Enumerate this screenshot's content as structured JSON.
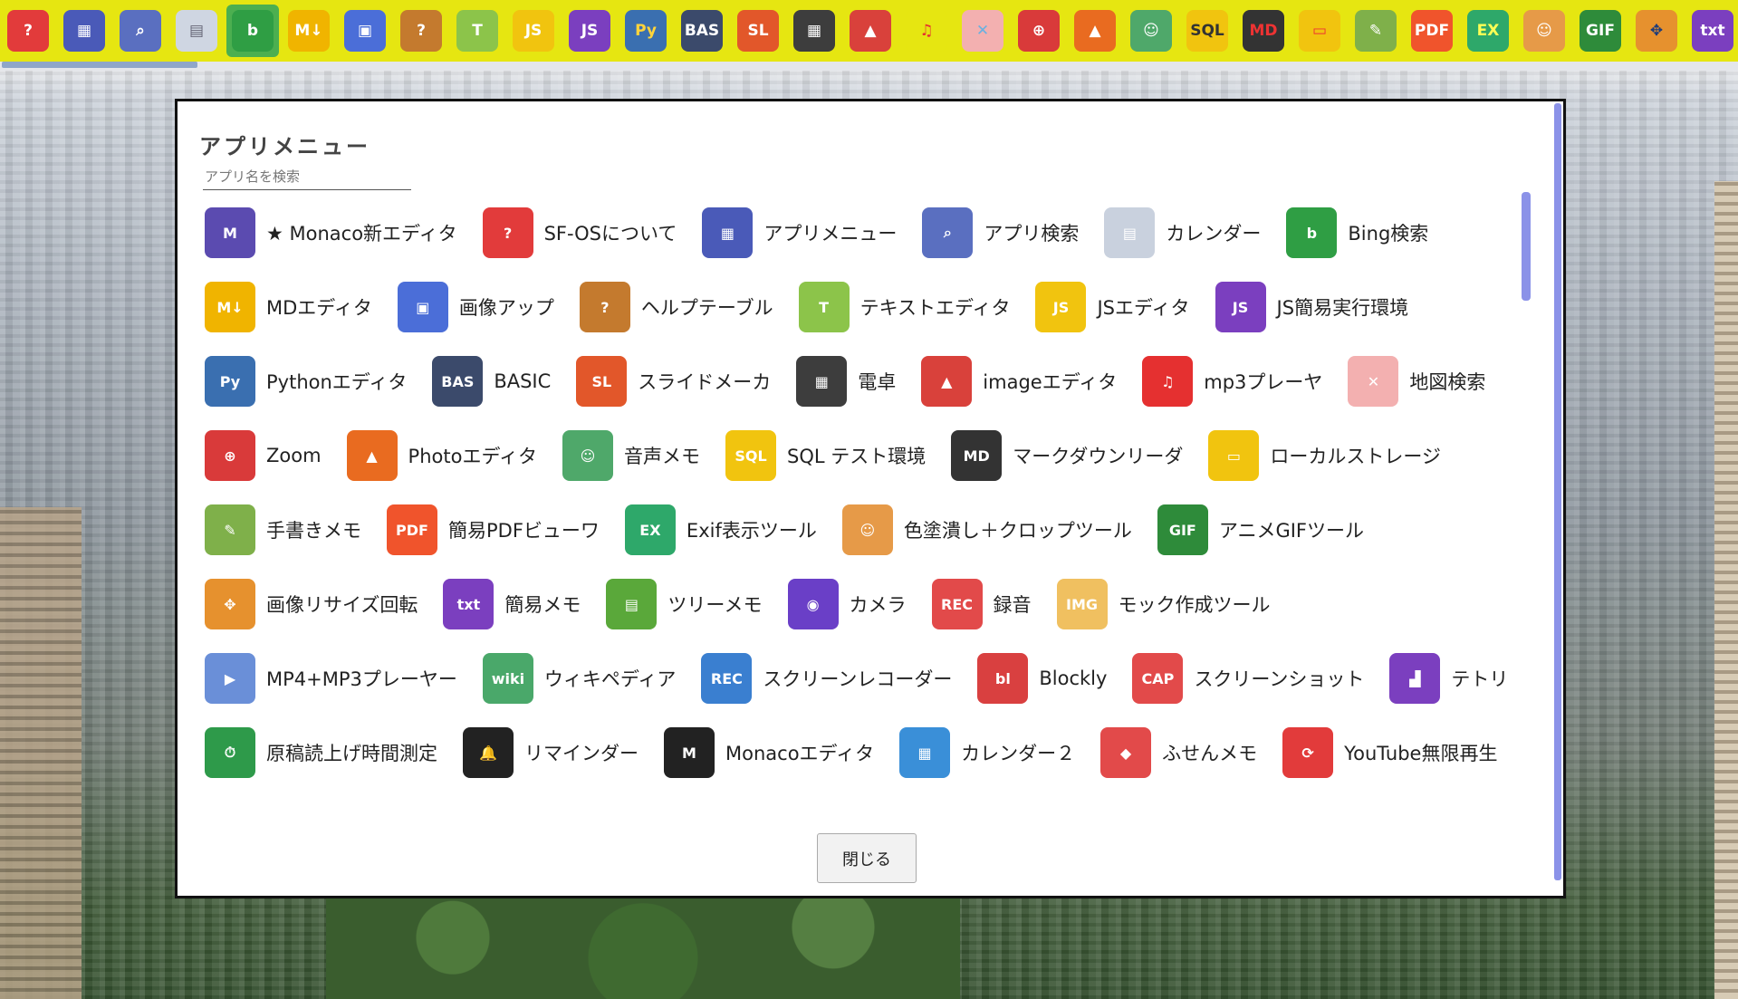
{
  "colors": {
    "taskbar": "#e6e611",
    "scrollbar": "#8b92e8",
    "dialog_border": "#111111"
  },
  "taskbar": {
    "items": [
      {
        "name": "help-icon",
        "glyph": "?",
        "bg": "#e23b3b",
        "fg": "#ffffff"
      },
      {
        "name": "app-menu-icon",
        "glyph": "▦",
        "bg": "#4a5ab8",
        "fg": "#ffffff"
      },
      {
        "name": "app-search-icon",
        "glyph": "⌕",
        "bg": "#5a6fc0",
        "fg": "#ffffff"
      },
      {
        "name": "calendar-icon",
        "glyph": "▤",
        "bg": "#cfd6e2",
        "fg": "#667"
      },
      {
        "name": "bing-icon",
        "glyph": "b",
        "bg": "#2f9e44",
        "fg": "#ffffff",
        "active": true
      },
      {
        "name": "md-editor-icon",
        "glyph": "M↓",
        "bg": "#f0b400",
        "fg": "#ffffff"
      },
      {
        "name": "image-up-icon",
        "glyph": "▣",
        "bg": "#4b6ed8",
        "fg": "#ffffff"
      },
      {
        "name": "help-table-icon",
        "glyph": "?",
        "bg": "#c47a2e",
        "fg": "#ffffff"
      },
      {
        "name": "text-editor-icon",
        "glyph": "T",
        "bg": "#8cc44a",
        "fg": "#ffffff"
      },
      {
        "name": "js-editor-icon",
        "glyph": "JS",
        "bg": "#f1c40f",
        "fg": "#ffffff"
      },
      {
        "name": "js-run-icon",
        "glyph": "JS",
        "bg": "#7b3fbf",
        "fg": "#ffffff"
      },
      {
        "name": "python-icon",
        "glyph": "Py",
        "bg": "#3a6fb0",
        "fg": "#ffd43b"
      },
      {
        "name": "basic-icon",
        "glyph": "BAS",
        "bg": "#3b4a6b",
        "fg": "#ffffff"
      },
      {
        "name": "slide-icon",
        "glyph": "SL",
        "bg": "#e2572a",
        "fg": "#ffffff"
      },
      {
        "name": "calculator-icon",
        "glyph": "▦",
        "bg": "#3d3d3d",
        "fg": "#ffffff"
      },
      {
        "name": "image-editor-icon",
        "glyph": "▲",
        "bg": "#d9413b",
        "fg": "#ffffff"
      },
      {
        "name": "music-icon",
        "glyph": "♫",
        "bg": "#e6e611",
        "fg": "#e53030"
      },
      {
        "name": "map-icon",
        "glyph": "✕",
        "bg": "#f3b0b0",
        "fg": "#6ab0e0"
      },
      {
        "name": "zoom-icon",
        "glyph": "⊕",
        "bg": "#d93a3a",
        "fg": "#ffffff"
      },
      {
        "name": "photo-editor-icon",
        "glyph": "▲",
        "bg": "#e96b20",
        "fg": "#ffffff"
      },
      {
        "name": "voice-memo-icon",
        "glyph": "☺",
        "bg": "#4fa86a",
        "fg": "#ffffff"
      },
      {
        "name": "sql-icon",
        "glyph": "SQL",
        "bg": "#f1c40f",
        "fg": "#333333"
      },
      {
        "name": "md-reader-icon",
        "glyph": "MD",
        "bg": "#333333",
        "fg": "#e33"
      },
      {
        "name": "storage-icon",
        "glyph": "▭",
        "bg": "#f1c40f",
        "fg": "#e33"
      },
      {
        "name": "handwrite-icon",
        "glyph": "✎",
        "bg": "#7fb04a",
        "fg": "#ffffff"
      },
      {
        "name": "pdf-icon",
        "glyph": "PDF",
        "bg": "#f0542c",
        "fg": "#ffffff"
      },
      {
        "name": "exif-icon",
        "glyph": "EX",
        "bg": "#2ea86a",
        "fg": "#ffff55"
      },
      {
        "name": "crop-icon",
        "glyph": "☺",
        "bg": "#e69a48",
        "fg": "#ffffff"
      },
      {
        "name": "gif-icon",
        "glyph": "GIF",
        "bg": "#2e8b3a",
        "fg": "#ffffff"
      },
      {
        "name": "rotate-icon",
        "glyph": "✥",
        "bg": "#e6912e",
        "fg": "#1c3b7a"
      },
      {
        "name": "memo-icon",
        "glyph": "txt",
        "bg": "#7b3fbf",
        "fg": "#ffffff"
      }
    ]
  },
  "dialog": {
    "title": "アプリメニュー",
    "search_placeholder": "アプリ名を検索",
    "close_label": "閉じる",
    "rows": [
      [
        {
          "label": "★ Monaco新エディタ",
          "icon": "laptop-icon",
          "glyph": "M",
          "bg": "#5b4bb0"
        },
        {
          "label": "SF-OSについて",
          "icon": "help-icon",
          "glyph": "?",
          "bg": "#e23b3b"
        },
        {
          "label": "アプリメニュー",
          "icon": "app-menu-icon",
          "glyph": "▦",
          "bg": "#4a5ab8"
        },
        {
          "label": "アプリ検索",
          "icon": "app-search-icon",
          "glyph": "⌕",
          "bg": "#5a6fc0"
        },
        {
          "label": "カレンダー",
          "icon": "calendar-icon",
          "glyph": "▤",
          "bg": "#c9d1de"
        },
        {
          "label": "Bing検索",
          "icon": "bing-icon",
          "glyph": "b",
          "bg": "#2f9e44"
        }
      ],
      [
        {
          "label": "MDエディタ",
          "icon": "md-editor-icon",
          "glyph": "M↓",
          "bg": "#f0b400"
        },
        {
          "label": "画像アップ",
          "icon": "image-up-icon",
          "glyph": "▣",
          "bg": "#4b6ed8"
        },
        {
          "label": "ヘルプテーブル",
          "icon": "help-table-icon",
          "glyph": "?",
          "bg": "#c47a2e"
        },
        {
          "label": "テキストエディタ",
          "icon": "text-editor-icon",
          "glyph": "T",
          "bg": "#8cc44a"
        },
        {
          "label": "JSエディタ",
          "icon": "js-editor-icon",
          "glyph": "JS",
          "bg": "#f1c40f"
        },
        {
          "label": "JS簡易実行環境",
          "icon": "js-run-icon",
          "glyph": "JS",
          "bg": "#7b3fbf"
        }
      ],
      [
        {
          "label": "Pythonエディタ",
          "icon": "python-icon",
          "glyph": "Py",
          "bg": "#3a6fb0"
        },
        {
          "label": "BASIC",
          "icon": "basic-icon",
          "glyph": "BAS",
          "bg": "#3b4a6b"
        },
        {
          "label": "スライドメーカ",
          "icon": "slide-icon",
          "glyph": "SL",
          "bg": "#e2572a"
        },
        {
          "label": "電卓",
          "icon": "calculator-icon",
          "glyph": "▦",
          "bg": "#3d3d3d"
        },
        {
          "label": "imageエディタ",
          "icon": "image-editor-icon",
          "glyph": "▲",
          "bg": "#d9413b"
        },
        {
          "label": "mp3プレーヤ",
          "icon": "music-icon",
          "glyph": "♫",
          "bg": "#e53030"
        },
        {
          "label": "地図検索",
          "icon": "map-icon",
          "glyph": "✕",
          "bg": "#f3b0b0"
        }
      ],
      [
        {
          "label": "Zoom",
          "icon": "zoom-icon",
          "glyph": "⊕",
          "bg": "#d93a3a"
        },
        {
          "label": "Photoエディタ",
          "icon": "photo-editor-icon",
          "glyph": "▲",
          "bg": "#e96b20"
        },
        {
          "label": "音声メモ",
          "icon": "voice-memo-icon",
          "glyph": "☺",
          "bg": "#4fa86a"
        },
        {
          "label": "SQL テスト環境",
          "icon": "sql-icon",
          "glyph": "SQL",
          "bg": "#f1c40f"
        },
        {
          "label": "マークダウンリーダ",
          "icon": "md-reader-icon",
          "glyph": "MD",
          "bg": "#333333"
        },
        {
          "label": "ローカルストレージ",
          "icon": "storage-icon",
          "glyph": "▭",
          "bg": "#f1c40f"
        }
      ],
      [
        {
          "label": "手書きメモ",
          "icon": "handwrite-icon",
          "glyph": "✎",
          "bg": "#7fb04a"
        },
        {
          "label": "簡易PDFビューワ",
          "icon": "pdf-icon",
          "glyph": "PDF",
          "bg": "#f0542c"
        },
        {
          "label": "Exif表示ツール",
          "icon": "exif-icon",
          "glyph": "EX",
          "bg": "#2ea86a"
        },
        {
          "label": "色塗潰し＋クロップツール",
          "icon": "crop-icon",
          "glyph": "☺",
          "bg": "#e69a48"
        },
        {
          "label": "アニメGIFツール",
          "icon": "gif-icon",
          "glyph": "GIF",
          "bg": "#2e8b3a"
        }
      ],
      [
        {
          "label": "画像リサイズ回転",
          "icon": "rotate-icon",
          "glyph": "✥",
          "bg": "#e6912e"
        },
        {
          "label": "簡易メモ",
          "icon": "memo-icon",
          "glyph": "txt",
          "bg": "#7b3fbf"
        },
        {
          "label": "ツリーメモ",
          "icon": "tree-memo-icon",
          "glyph": "▤",
          "bg": "#5aa83a"
        },
        {
          "label": "カメラ",
          "icon": "camera-icon",
          "glyph": "◉",
          "bg": "#6a3fc7"
        },
        {
          "label": "録音",
          "icon": "mic-icon",
          "glyph": "REC",
          "bg": "#e24a4a"
        },
        {
          "label": "モック作成ツール",
          "icon": "mock-icon",
          "glyph": "IMG",
          "bg": "#f0c060"
        }
      ],
      [
        {
          "label": "MP4+MP3プレーヤー",
          "icon": "video-icon",
          "glyph": "▶",
          "bg": "#6a8fd8"
        },
        {
          "label": "ウィキペディア",
          "icon": "wiki-icon",
          "glyph": "wiki",
          "bg": "#4aa86a"
        },
        {
          "label": "スクリーンレコーダー",
          "icon": "screen-rec-icon",
          "glyph": "REC",
          "bg": "#3a7fd0"
        },
        {
          "label": "Blockly",
          "icon": "blockly-icon",
          "glyph": "bl",
          "bg": "#d94040"
        },
        {
          "label": "スクリーンショット",
          "icon": "screenshot-icon",
          "glyph": "CAP",
          "bg": "#e24a4a"
        },
        {
          "label": "テトリス",
          "icon": "tetris-icon",
          "glyph": "▟",
          "bg": "#7b3fbf"
        }
      ],
      [
        {
          "label": "原稿読上げ時間測定",
          "icon": "timer-icon",
          "glyph": "⏱",
          "bg": "#2e9a4a"
        },
        {
          "label": "リマインダー",
          "icon": "bell-icon",
          "glyph": "🔔",
          "bg": "#222222"
        },
        {
          "label": "Monacoエディタ",
          "icon": "monaco-icon",
          "glyph": "M",
          "bg": "#222222"
        },
        {
          "label": "カレンダー２",
          "icon": "calendar2-icon",
          "glyph": "▦",
          "bg": "#3a8fd8"
        },
        {
          "label": "ふせんメモ",
          "icon": "tag-icon",
          "glyph": "◆",
          "bg": "#e24a4a"
        },
        {
          "label": "YouTube無限再生",
          "icon": "youtube-icon",
          "glyph": "⟳",
          "bg": "#e23b3b"
        }
      ]
    ]
  }
}
